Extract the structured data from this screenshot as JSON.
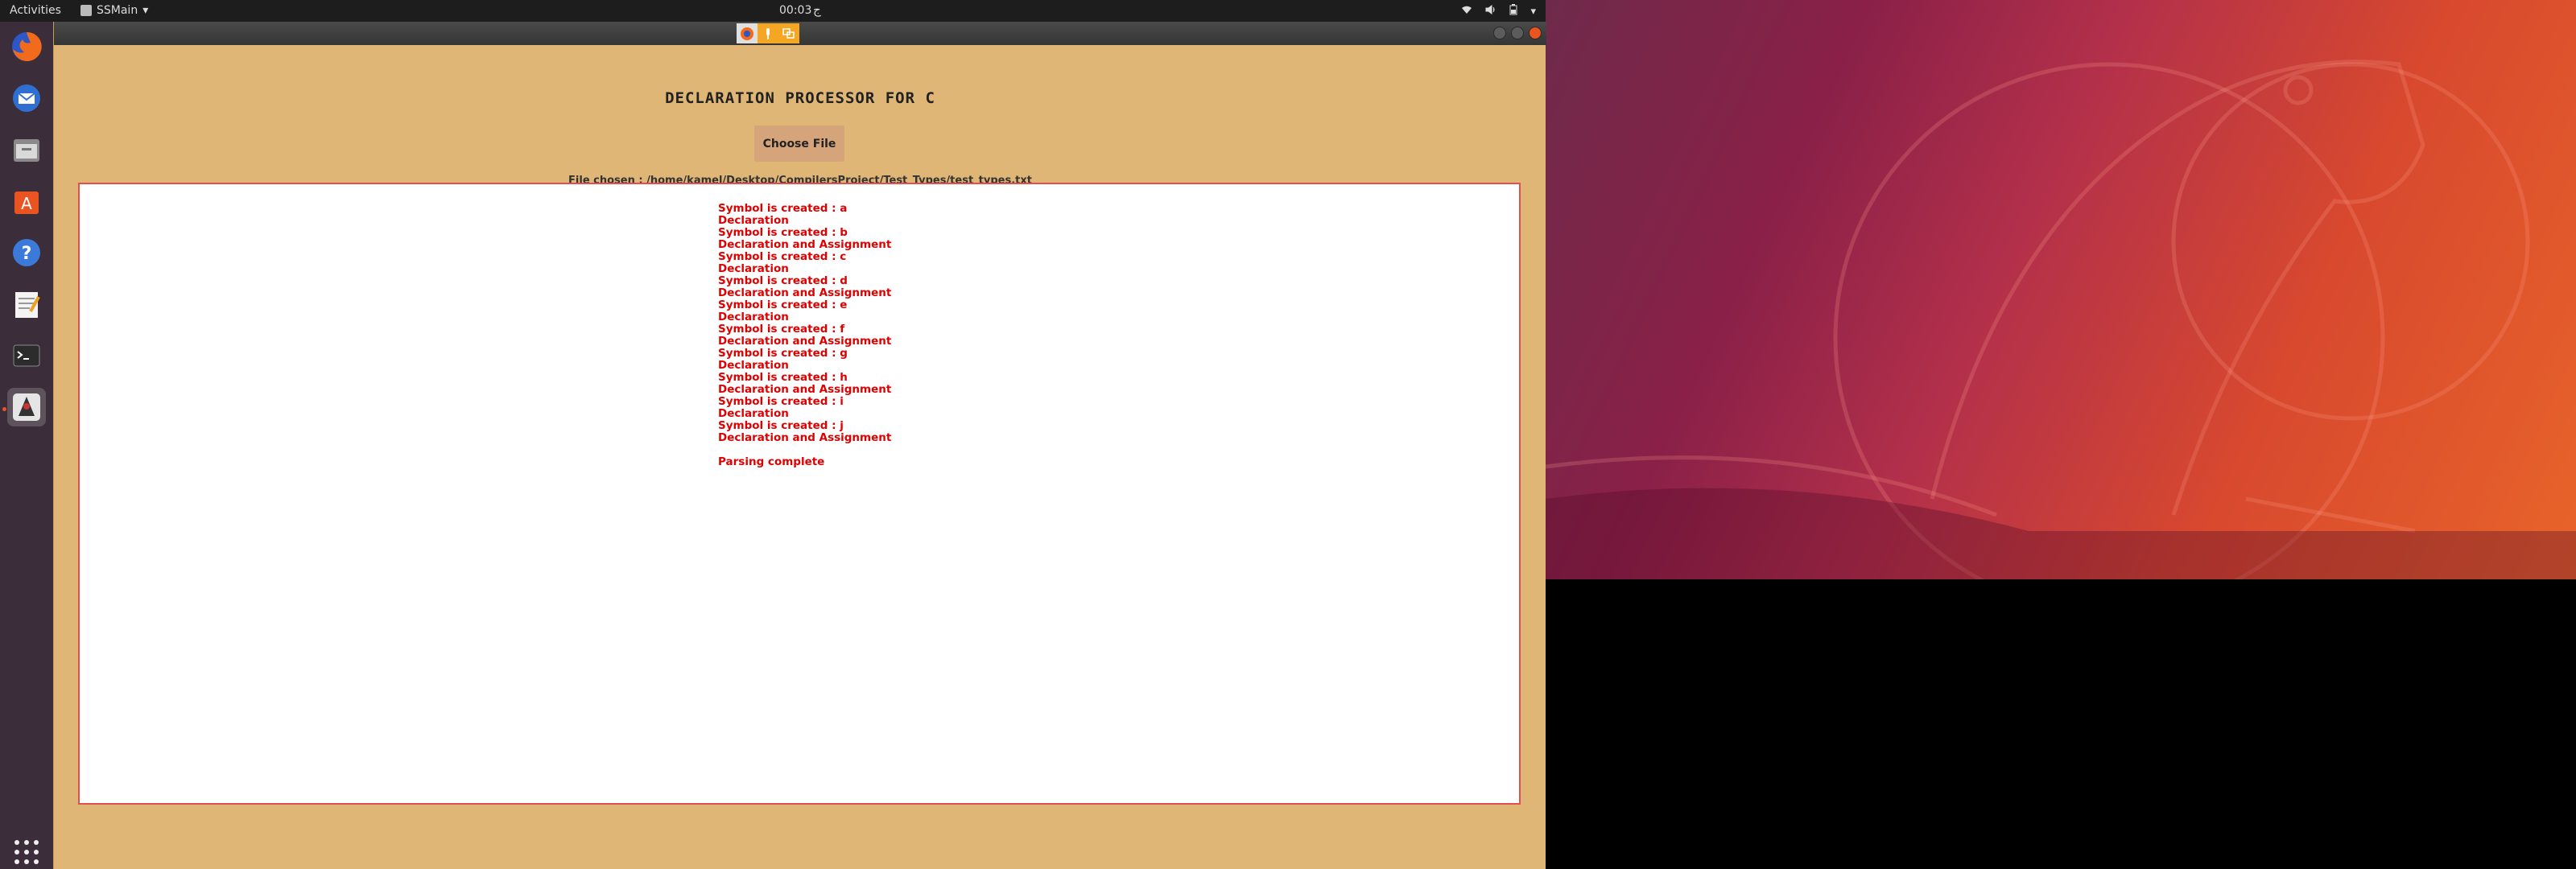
{
  "topbar": {
    "activities": "Activities",
    "app_name": "SSMain",
    "clock": "00:03",
    "ime": "ج"
  },
  "dock": {
    "items": [
      "firefox-icon",
      "thunderbird-icon",
      "files-icon",
      "software-icon",
      "help-icon",
      "text-editor-icon",
      "terminal-icon",
      "java-app-icon"
    ]
  },
  "window": {
    "title": "DECLARATION PROCESSOR FOR C",
    "choose_label": "Choose File",
    "file_label": "File chosen : ",
    "file_path": "/home/kamel/Desktop/CompilersProject/Test_Types/test_types.txt",
    "output": [
      "Symbol is created : a",
      "Declaration",
      "Symbol is created : b",
      "Declaration and Assignment",
      "Symbol is created : c",
      "Declaration",
      "Symbol is created : d",
      "Declaration and Assignment",
      "Symbol is created : e",
      "Declaration",
      "Symbol is created : f",
      "Declaration and Assignment",
      "Symbol is created : g",
      "Declaration",
      "Symbol is created : h",
      "Declaration and Assignment",
      "Symbol is created : i",
      "Declaration",
      "Symbol is created : j",
      "Declaration and Assignment"
    ],
    "parse_complete": "Parsing complete"
  }
}
